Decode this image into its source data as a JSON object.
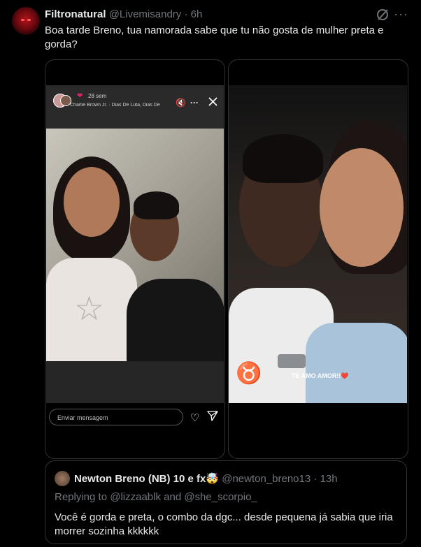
{
  "tweet": {
    "author_name": "Filtronatural",
    "handle": "@Livemisandry",
    "time": "6h",
    "separator": "·",
    "text": "Boa tarde Breno, tua namorada sabe que tu não gosta de mulher preta e gorda?",
    "more": "···"
  },
  "left_story": {
    "time": "28 sem",
    "music": "Charlie Brown Jr. · Dias De Luta, Dias De",
    "input_placeholder": "Enviar mensagem"
  },
  "right_story": {
    "caption": "TE AMO AMOR!!❤️"
  },
  "quote": {
    "author_name": "Newton Breno (NB) 10 e fx🤯",
    "handle": "@newton_breno13",
    "separator": "·",
    "time": "13h",
    "replying": "Replying to @lizzaablk and @she_scorpio_",
    "text": "Você é gorda e preta, o combo da dgc... desde pequena já sabia que iria morrer sozinha kkkkkk"
  },
  "colors": {
    "background": "#000000",
    "text": "#e7e9ea",
    "muted": "#71767b",
    "border": "#2f3336",
    "heart": "#e0245e"
  }
}
